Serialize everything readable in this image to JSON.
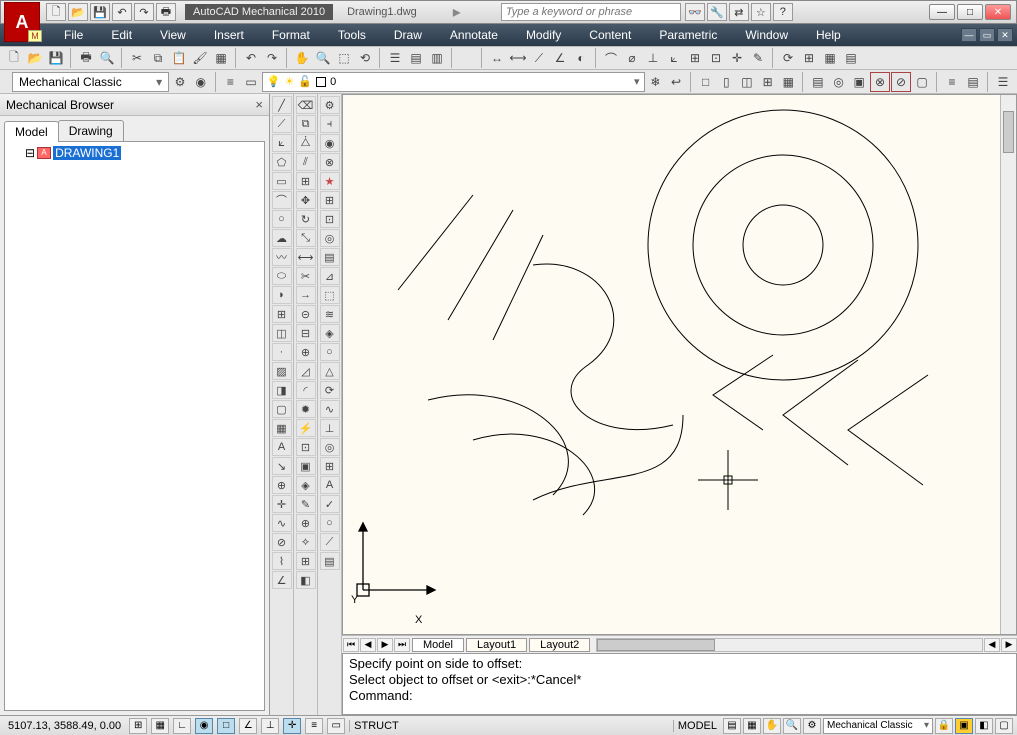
{
  "titlebar": {
    "app_title": "AutoCAD Mechanical 2010",
    "document": "Drawing1.dwg",
    "search_placeholder": "Type a keyword or phrase"
  },
  "logo": {
    "letter": "A",
    "sub": "M"
  },
  "menu": {
    "items": [
      "File",
      "Edit",
      "View",
      "Insert",
      "Format",
      "Tools",
      "Draw",
      "Annotate",
      "Modify",
      "Content",
      "Parametric",
      "Window",
      "Help"
    ]
  },
  "workspace_dropdown": "Mechanical Classic",
  "layer_dropdown": {
    "layer_name": "0"
  },
  "browser": {
    "title": "Mechanical Browser",
    "tabs": [
      "Model",
      "Drawing"
    ],
    "active_tab": 0,
    "tree_root": "DRAWING1"
  },
  "layout_tabs": {
    "tabs": [
      "Model",
      "Layout1",
      "Layout2"
    ],
    "active": 0
  },
  "command": {
    "line1": "Specify point on side to offset:",
    "line2": "Select object to offset or <exit>:*Cancel*",
    "line3": "Command:"
  },
  "statusbar": {
    "coords": "5107.13, 3588.49, 0.00",
    "struct": "STRUCT",
    "model": "MODEL",
    "workspace": "Mechanical Classic"
  },
  "axes": {
    "x": "X",
    "y": "Y"
  }
}
